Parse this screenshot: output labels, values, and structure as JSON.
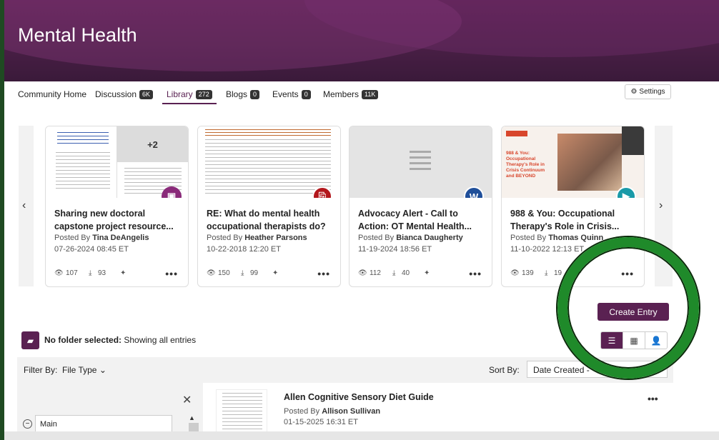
{
  "header": {
    "title": "Mental Health"
  },
  "tabs": [
    {
      "label": "Community Home",
      "badge": ""
    },
    {
      "label": "Discussion",
      "badge": "6K"
    },
    {
      "label": "Library",
      "badge": "272"
    },
    {
      "label": "Blogs",
      "badge": "0"
    },
    {
      "label": "Events",
      "badge": "0"
    },
    {
      "label": "Members",
      "badge": "11K"
    }
  ],
  "settings_label": "Settings",
  "cards": [
    {
      "title": "Sharing new doctoral capstone project resource...",
      "posted_by_label": "Posted By",
      "author": "Tina DeAngelis",
      "date": "07-26-2024 08:45 ET",
      "views": "107",
      "downloads": "93",
      "thumb_badge": "+2",
      "type_icon": "copy-files-icon",
      "type_color": "#8a2a7a"
    },
    {
      "title": "RE: What do mental health occupational therapists do?",
      "posted_by_label": "Posted By",
      "author": "Heather Parsons",
      "date": "10-22-2018 12:20 ET",
      "views": "150",
      "downloads": "99",
      "type_icon": "pdf-icon",
      "type_color": "#b3171c"
    },
    {
      "title": "Advocacy Alert - Call to Action: OT Mental Health...",
      "posted_by_label": "Posted By",
      "author": "Bianca Daugherty",
      "date": "11-19-2024 18:56 ET",
      "views": "112",
      "downloads": "40",
      "type_icon": "word-icon",
      "type_color": "#1f4f9a",
      "type_letter": "W"
    },
    {
      "title": "988 & You: Occupational Therapy's Role in Crisis...",
      "posted_by_label": "Posted By",
      "author": "Thomas Quinn",
      "date": "11-10-2022 12:13 ET",
      "views": "139",
      "downloads": "19",
      "type_icon": "video-play-icon",
      "type_color": "#1a9aa8",
      "slide_text": "988 & You: Occupational Therapy's Role in Crisis Continuum and BEYOND"
    }
  ],
  "create_entry_label": "Create Entry",
  "folder": {
    "bold": "No folder selected:",
    "rest": " Showing all entries"
  },
  "filter": {
    "label": "Filter By:",
    "type": "File Type"
  },
  "sort": {
    "label": "Sort By:",
    "value": "Date Created -"
  },
  "tree": {
    "root": "Main"
  },
  "entry": {
    "title": "Allen Cognitive Sensory Diet Guide",
    "posted_by_label": "Posted By",
    "author": "Allison Sullivan",
    "date": "01-15-2025 16:31 ET"
  },
  "colors": {
    "brand": "#5a2152",
    "highlight_ring": "#1f8a2a"
  }
}
